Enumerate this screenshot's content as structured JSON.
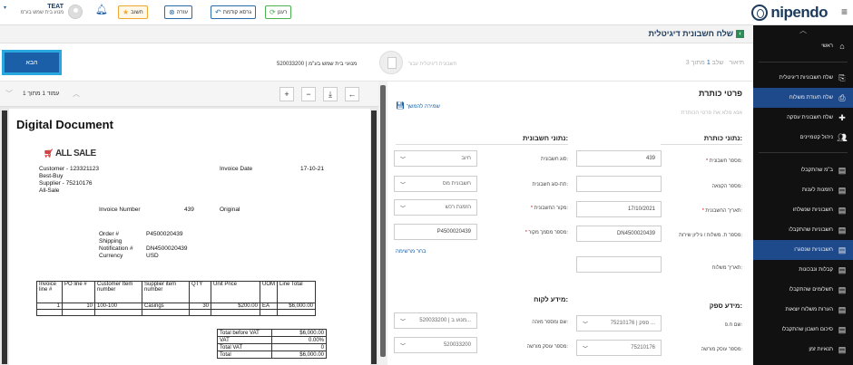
{
  "brand": {
    "logo_text": "nipendo"
  },
  "user": {
    "name": "TEAT",
    "subtitle": "מנוע בית שמש בע\"מ"
  },
  "toolbar": {
    "refresh_label": "רענן",
    "back_label": "גרסא קודמת",
    "help_label": "עזרה",
    "important_label": "חשוב"
  },
  "sidebar": {
    "items": [
      {
        "label": "ראשי",
        "icon": "home-icon"
      },
      {
        "label": "שלח חשבוניות דיגיטלית",
        "icon": "send-digital-icon"
      },
      {
        "label": "שלח תעודת משלוח",
        "icon": "delivery-note-icon"
      },
      {
        "label": "שלח חשבונית עסקה",
        "icon": "pro-invoice-icon"
      },
      {
        "label": "ניהול קטמיינים",
        "icon": "users-icon"
      },
      {
        "label": "ב\"מ שהתקבלו",
        "icon": "doc-received-icon"
      },
      {
        "label": "הזמנות לענות",
        "icon": "orders-icon"
      },
      {
        "label": "חשבוניות שנשלחו",
        "icon": "sent-invoices-icon"
      },
      {
        "label": "חשבוניות שהתקבלו",
        "icon": "received-invoices-icon"
      },
      {
        "label": "חשבוניות שנסגרו",
        "icon": "closed-invoices-icon"
      },
      {
        "label": "קבלות ונבכונות",
        "icon": "receipts-icon"
      },
      {
        "label": "תשלומים שהתקבלו",
        "icon": "payments-icon"
      },
      {
        "label": "הערות משלוח יוצאות",
        "icon": "outgoing-notes-icon"
      },
      {
        "label": "סיכום חשבון שהתקבלו",
        "icon": "summary-icon"
      },
      {
        "label": "תנאיות זמן",
        "icon": "time-terms-icon"
      }
    ]
  },
  "page": {
    "title": "שלח חשבונית דיגיטלית"
  },
  "stepbar": {
    "next_label": "הבא",
    "step_prefix": "תיאור",
    "step_text": "שלב",
    "step_current": "1",
    "step_suffix": "מתוך 3",
    "company": "520033200 | מנועי בית שמש בע\"מ",
    "digital_text": "חשבונית דיגיטלית עבור"
  },
  "viewer": {
    "page_info": "עמוד 1 מתוך 1",
    "zoom_in": "+",
    "zoom_out": "−",
    "download": "⤓",
    "back": "←",
    "doc": {
      "title": "Digital Document",
      "brand": "ALL SALE",
      "customer": "Customer - 123321123",
      "customer_name": "Best-Buy",
      "supplier": "Supplier - 75210176",
      "supplier_name": "All-Sale",
      "invoice_date_label": "Invoice Date",
      "invoice_date": "17-10-21",
      "invoice_number_label": "Invoice Number",
      "invoice_number": "439",
      "invoice_type": "Original",
      "order_label": "Order #",
      "order_value": "P4500020439",
      "shipping_label": "Shipping",
      "notification_label": "Notification #",
      "notification_value": "DN4500020439",
      "currency_label": "Currency",
      "currency_value": "USD",
      "table_headers": [
        "Invoice line #",
        "PO line #",
        "Customer Item number",
        "Supplier item number",
        "QTY",
        "Unit Price",
        "UOM",
        "Line Total"
      ],
      "table_row": [
        "1",
        "10",
        "100-100",
        "Casings",
        "30",
        "$200.00",
        "EA",
        "$6,000.00"
      ],
      "totals": [
        [
          "Total before VAT",
          "$6,000.00"
        ],
        [
          "VAT",
          "0.00%"
        ],
        [
          "Total VAT",
          "0"
        ],
        [
          "Total",
          "$6,000.00"
        ]
      ]
    }
  },
  "form": {
    "header_title": "פרטי כותרת",
    "header_hint": "אנא מלא את פרטי הכותרת",
    "save_link": "שמירה להמשך",
    "header_section": "נתוני כותרת:",
    "invoice_section": "נתוני חשבונית:",
    "fields": {
      "invoice_number_label": "מספר חשבונית:",
      "invoice_number_value": "439",
      "po_label": "מספר הקצאה:",
      "po_value": "",
      "invoice_date_label": "תאריך החשבונית:",
      "invoice_date_value": "17/10/2021",
      "delivery_label": "מספר ת. משלוח / גיליון שירות:",
      "delivery_value": "DN4500020439",
      "ship_date_label": "תאריך משלוח:",
      "ship_date_value": "",
      "type_label": "סוג חשבונית:",
      "type_value": "חיוב",
      "subtype_label": "תת-סוג חשבונית:",
      "subtype_value": "חשבונית מס",
      "source_label": "מקור החשבונית:",
      "source_value": "הזמנת רכש",
      "source_num_label": "מספר מסמך מקור:",
      "source_num_value": "P4500020439",
      "pick_list_link": "בחר מרשימה"
    },
    "supplier_section": "מידע ספק:",
    "customer_section": "מידע לקוח:",
    "supplier_fields": {
      "name_label": "שם ח.פ:",
      "name_value": "75210176 | ספק ...",
      "dealer_label": "מספר עוסק מורשה:",
      "dealer_value": "75210176"
    },
    "customer_fields": {
      "name_label": "שם ומספר מזהה:",
      "name_value": "520033200 | מנוע ב...",
      "dealer_label": "מספר עוסק מורשה:",
      "dealer_value": "520033200"
    }
  }
}
